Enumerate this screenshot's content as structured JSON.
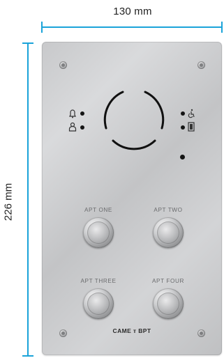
{
  "dimensions": {
    "width_label": "130 mm",
    "height_label": "226 mm",
    "line_color": "#1aa3d9"
  },
  "panel": {
    "buttons": [
      {
        "label": "APT ONE"
      },
      {
        "label": "APT TWO"
      },
      {
        "label": "APT THREE"
      },
      {
        "label": "APT FOUR"
      }
    ],
    "brand": "CAME ᴛ BPT",
    "status_icons_left": [
      "bell-icon",
      "person-icon"
    ],
    "status_icons_right": [
      "accessibility-icon",
      "door-icon"
    ]
  }
}
